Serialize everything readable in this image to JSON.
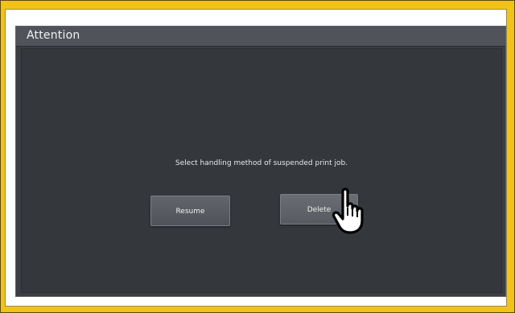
{
  "dialog": {
    "title": "Attention",
    "message": "Select handling method of suspended print job.",
    "buttons": {
      "resume_label": "Resume",
      "delete_label": "Delete"
    }
  },
  "overlay": {
    "pointer_icon": "hand-pointer-icon"
  },
  "colors": {
    "frame": "#f2c21b",
    "dialog_bg": "#3a3d42",
    "button_bg": "#5a5e64"
  }
}
